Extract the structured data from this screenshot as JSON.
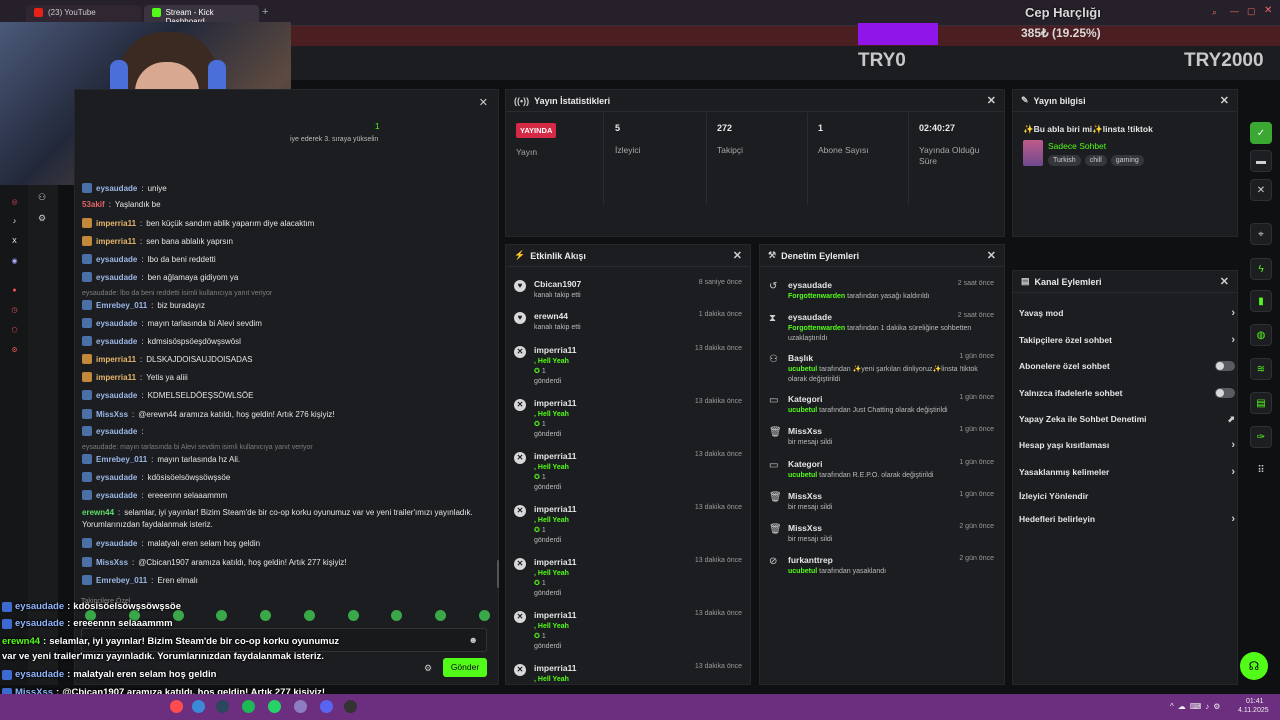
{
  "browser": {
    "tabs": [
      {
        "label": "(23) YouTube",
        "color": "#e62117"
      },
      {
        "label": "Stream - Kick Dashboard",
        "color": "#53fc18"
      }
    ]
  },
  "overlay": {
    "goal_title": "Cep Harçlığı",
    "goal_value": "385₺ (19.25%)",
    "goal_progress": 0.1925,
    "goal_min": "TRY0",
    "goal_max": "TRY2000"
  },
  "chat": {
    "top_count": "1",
    "top_text": "iye ederek 3. sıraya yükselin",
    "lines": [
      {
        "name": "eysaudade",
        "text": "uniye",
        "cls": "name-b"
      },
      {
        "name": "53akif",
        "text": "Yaşlandık be",
        "cls": "name-r"
      },
      {
        "name": "imperria11",
        "text": "ben küçük sandım ablik yaparım diye alacaktım",
        "cls": "name-o"
      },
      {
        "name": "imperria11",
        "text": "sen bana ablalık yaprsın",
        "cls": "name-o"
      },
      {
        "name": "eysaudade",
        "text": "lbo da beni reddetti",
        "cls": "name-b"
      },
      {
        "name": "eysaudade",
        "text": "ben ağlamaya gidiyom ya",
        "cls": "name-b"
      },
      {
        "name": "",
        "text": "eysaudade: lbo da beni reddetti isimli kullanıcıya yanıt veriyor",
        "cls": "sys"
      },
      {
        "name": "Emrebey_011",
        "text": "biz buradayız",
        "cls": "name-b"
      },
      {
        "name": "eysaudade",
        "text": "mayın tarlasında bi Alevi sevdim",
        "cls": "name-b"
      },
      {
        "name": "eysaudade",
        "text": "kdmsisöspsöeşdöwşswösl",
        "cls": "name-b"
      },
      {
        "name": "imperria11",
        "text": "DLSKAJDOISAUJDOISADAS",
        "cls": "name-o"
      },
      {
        "name": "imperria11",
        "text": "Yetis ya aliii",
        "cls": "name-o"
      },
      {
        "name": "eysaudade",
        "text": "KDMELSELDÖEŞSÖWLSÖE",
        "cls": "name-b"
      },
      {
        "name": "MissXss",
        "text": "@erewn44 aramıza katıldı, hoş geldin! Artık 276 kişiyiz!",
        "cls": "name-b"
      },
      {
        "name": "eysaudade",
        "text": "",
        "cls": "name-b"
      },
      {
        "name": "",
        "text": "eysaudade: mayın tarlasında bi Alevi sevdim isimli kullanıcıya yanıt veriyor",
        "cls": "sys"
      },
      {
        "name": "Emrebey_011",
        "text": "mayın tarlasında hz Ali.",
        "cls": "name-b"
      },
      {
        "name": "eysaudade",
        "text": "kdösisöelsöwşsöwşsöe",
        "cls": "name-b"
      },
      {
        "name": "eysaudade",
        "text": "ereeennn selaaammm",
        "cls": "name-b"
      },
      {
        "name": "erewn44",
        "text": "selamlar, iyi yayınlar! Bizim Steam'de bir co-op korku oyunumuz var ve yeni trailer'ımızı yayınladık.",
        "cls": "name-g"
      },
      {
        "name": "",
        "text": "Yorumlarınızdan faydalanmak isteriz.",
        "cls": "plain"
      },
      {
        "name": "eysaudade",
        "text": "malatyalı eren selam hoş geldin",
        "cls": "name-b"
      },
      {
        "name": "MissXss",
        "text": "@Cbican1907 aramıza katıldı, hoş geldin! Artık 277 kişiyiz!",
        "cls": "name-b"
      },
      {
        "name": "Emrebey_011",
        "text": "Eren elmalı",
        "cls": "name-b"
      }
    ],
    "section_label": "Takipçilere Özel",
    "send_label": "Gönder"
  },
  "overlay_chat": [
    {
      "name": "eysaudade",
      "text": "kdösisöelsöwşsöwşsöe",
      "color": "#ffffff"
    },
    {
      "name": "eysaudade",
      "text": "ereeennn selaaammm",
      "color": "#ffffff"
    },
    {
      "name": "erewn44",
      "text": "selamlar, iyi yayınlar! Bizim Steam'de bir co-op korku oyunumuz",
      "color": "#53fc18"
    },
    {
      "name": "",
      "text": "var ve yeni trailer'ımızı yayınladık. Yorumlarınızdan faydalanmak isteriz.",
      "color": "#ffffff"
    },
    {
      "name": "eysaudade",
      "text": "malatyalı eren selam hoş geldin",
      "color": "#ffffff"
    },
    {
      "name": "MissXss",
      "text": "@Cbican1907 aramıza katıldı, hoş geldin! Artık 277 kişiyiz!",
      "color": "#ffffff"
    },
    {
      "name": "Emrebey_011",
      "text": "Eren elmalı",
      "color": "#ffffff"
    }
  ],
  "stats": {
    "title": "Yayın İstatistikleri",
    "live_badge": "YAYINDA",
    "items": [
      {
        "value": "",
        "label": "Yayın"
      },
      {
        "value": "5",
        "label": "İzleyici"
      },
      {
        "value": "272",
        "label": "Takipçi"
      },
      {
        "value": "1",
        "label": "Abone Sayısı"
      },
      {
        "value": "02:40:27",
        "label": "Yayında Olduğu Süre"
      }
    ]
  },
  "info": {
    "title": "Yayın bilgisi",
    "stream_title": "✨Bu abla biri mi✨linsta !tiktok",
    "category": "Sadece Sohbet",
    "tags": [
      "Turkish",
      "chill",
      "gaming"
    ]
  },
  "activity": {
    "title": "Etkinlik Akışı",
    "events": [
      {
        "name": "Cbican1907",
        "sub": "kanalı takip etti",
        "sub2": "",
        "time": "8 saniye önce",
        "icon": "♥"
      },
      {
        "name": "erewn44",
        "sub": "kanalı takip etti",
        "sub2": "",
        "time": "1 dakika önce",
        "icon": "♥"
      },
      {
        "name": "imperria11",
        "sub": ", Hell Yeah",
        "sub2": "1 gönderdi",
        "time": "13 dakika önce",
        "icon": "✕"
      },
      {
        "name": "imperria11",
        "sub": ", Hell Yeah",
        "sub2": "1 gönderdi",
        "time": "13 dakika önce",
        "icon": "✕"
      },
      {
        "name": "imperria11",
        "sub": ", Hell Yeah",
        "sub2": "1 gönderdi",
        "time": "13 dakika önce",
        "icon": "✕"
      },
      {
        "name": "imperria11",
        "sub": ", Hell Yeah",
        "sub2": "1 gönderdi",
        "time": "13 dakika önce",
        "icon": "✕"
      },
      {
        "name": "imperria11",
        "sub": ", Hell Yeah",
        "sub2": "1 gönderdi",
        "time": "13 dakika önce",
        "icon": "✕"
      },
      {
        "name": "imperria11",
        "sub": ", Hell Yeah",
        "sub2": "1 gönderdi",
        "time": "13 dakika önce",
        "icon": "✕"
      },
      {
        "name": "imperria11",
        "sub": ", Hell Yeah",
        "sub2": "",
        "time": "13 dakika önce",
        "icon": "✕"
      }
    ]
  },
  "moderation": {
    "title": "Denetim Eylemleri",
    "items": [
      {
        "name": "eysaudade",
        "actor": "Forgottenwarden",
        "text": "tarafından yasağı kaldırıldı",
        "time": "2 saat önce",
        "icon": "↺"
      },
      {
        "name": "eysaudade",
        "actor": "Forgottenwarden",
        "text": "tarafından 1 dakika süreliğine sohbetten uzaklaştırıldı",
        "time": "2 saat önce",
        "icon": "⧗"
      },
      {
        "name": "Başlık",
        "actor": "ucubetul",
        "text": "tarafından ✨yeni şarkıları dinliyoruz✨linsta !tiktok olarak değiştirildi",
        "time": "1 gün önce",
        "icon": "⚇"
      },
      {
        "name": "Kategori",
        "actor": "ucubetul",
        "text": "tarafından Just Chatting olarak değiştirildi",
        "time": "1 gün önce",
        "icon": "▭"
      },
      {
        "name": "MissXss",
        "actor": "",
        "text": "bir mesajı sildi",
        "time": "1 gün önce",
        "icon": "🗑"
      },
      {
        "name": "Kategori",
        "actor": "ucubetul",
        "text": "tarafından R.E.P.O. olarak değiştirildi",
        "time": "1 gün önce",
        "icon": "▭"
      },
      {
        "name": "MissXss",
        "actor": "",
        "text": "bir mesajı sildi",
        "time": "1 gün önce",
        "icon": "🗑"
      },
      {
        "name": "MissXss",
        "actor": "",
        "text": "bir mesajı sildi",
        "time": "2 gün önce",
        "icon": "🗑"
      },
      {
        "name": "furkanttrep",
        "actor": "ucubetul",
        "text": "tarafından yasaklandı",
        "time": "2 gün önce",
        "icon": "⊘"
      }
    ]
  },
  "channel": {
    "title": "Kanal Eylemleri",
    "items": [
      {
        "label": "Yavaş mod",
        "kind": "arrow"
      },
      {
        "label": "Takipçilere özel sohbet",
        "kind": "arrow"
      },
      {
        "label": "Abonelere özel sohbet",
        "kind": "toggle"
      },
      {
        "label": "Yalnızca ifadelerle sohbet",
        "kind": "toggle"
      },
      {
        "label": "Yapay Zeka ile Sohbet Denetimi",
        "kind": "ext"
      },
      {
        "label": "Hesap yaşı kısıtlaması",
        "kind": "arrow"
      },
      {
        "label": "Yasaklanmış kelimeler",
        "kind": "arrow"
      },
      {
        "label": "İzleyici Yönlendir",
        "kind": "none"
      },
      {
        "label": "Hedefleri belirleyin",
        "kind": "arrow"
      }
    ]
  },
  "taskbar": {
    "time": "01:41",
    "date": "4.11.2025"
  }
}
